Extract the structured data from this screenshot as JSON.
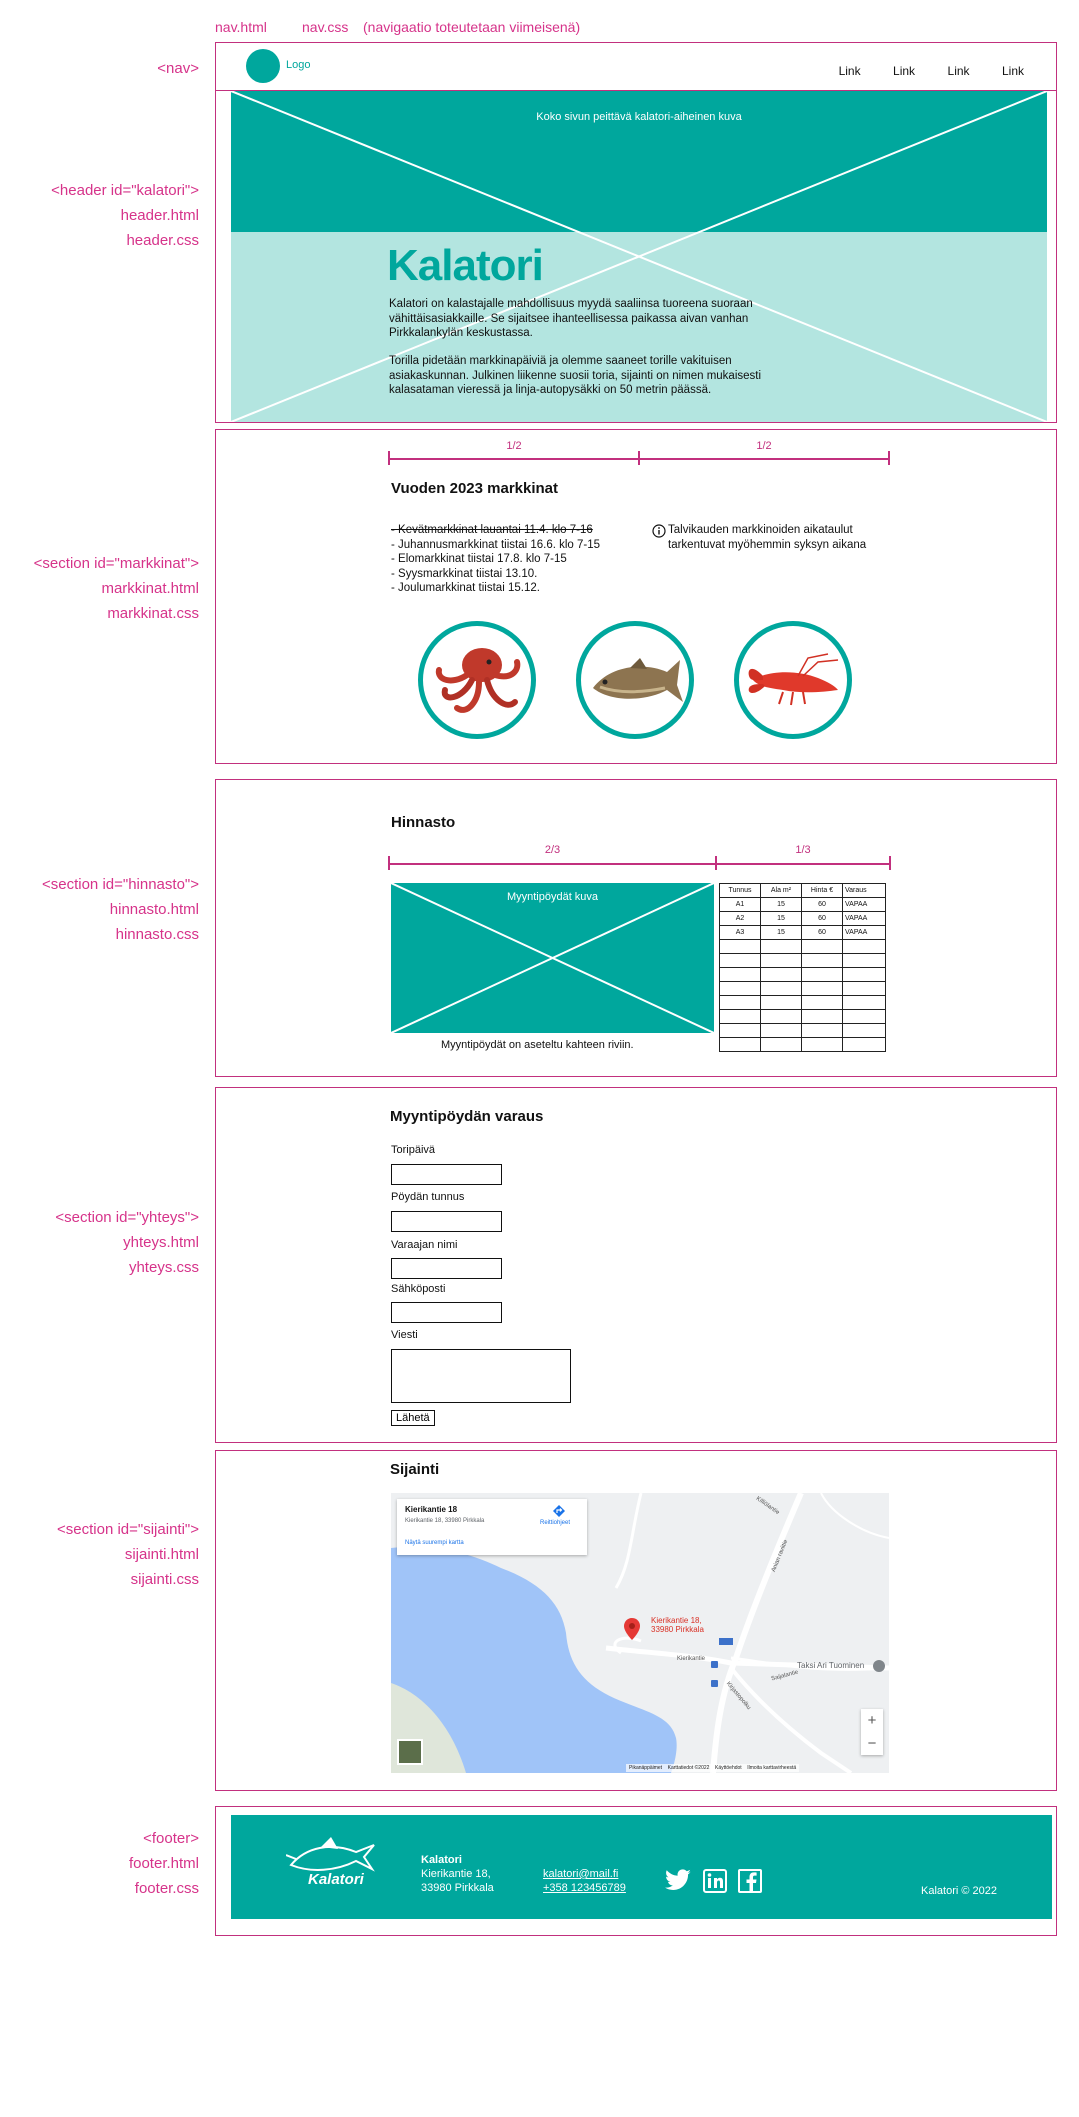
{
  "top_files": {
    "nav_html": "nav.html",
    "nav_css": "nav.css",
    "nav_note": "(navigaatio toteutetaan viimeisenä)"
  },
  "labels": {
    "nav": "<nav>",
    "header": [
      "<header id=\"kalatori\">",
      "header.html",
      "header.css"
    ],
    "markkinat": [
      "<section id=\"markkinat\">",
      "markkinat.html",
      "markkinat.css"
    ],
    "hinnasto": [
      "<section id=\"hinnasto\">",
      "hinnasto.html",
      "hinnasto.css"
    ],
    "yhteys": [
      "<section id=\"yhteys\">",
      "yhteys.html",
      "yhteys.css"
    ],
    "sijainti": [
      "<section id=\"sijainti\">",
      "sijainti.html",
      "sijainti.css"
    ],
    "footer": [
      "<footer>",
      "footer.html",
      "footer.css"
    ]
  },
  "nav": {
    "logo": "Logo",
    "links": [
      "Link",
      "Link",
      "Link",
      "Link"
    ]
  },
  "header": {
    "image_caption": "Koko sivun peittävä kalatori-aiheinen kuva",
    "title": "Kalatori",
    "paragraph1": "Kalatori on kalastajalle mahdollisuus myydä saaliinsa tuoreena suoraan vähittäisasiakkaille. Se sijaitsee ihanteellisessa paikassa aivan vanhan Pirkkalankylän keskustassa.",
    "paragraph2": "Torilla pidetään markkinapäiviä ja olemme saaneet torille vakituisen asiakaskunnan. Julkinen liikenne suosii toria, sijainti on nimen mukaisesti kalasataman vieressä ja linja-autopysäkki on 50 metrin päässä."
  },
  "markkinat": {
    "col_left": "1/2",
    "col_right": "1/2",
    "title": "Vuoden 2023 markkinat",
    "items": [
      "- Kevätmarkkinat lauantai 11.4. klo 7-16",
      "- Juhannusmarkkinat tiistai 16.6. klo 7-15",
      "- Elomarkkinat tiistai 17.8. klo 7-15",
      "- Syysmarkkinat tiistai 13.10.",
      "- Joulumarkkinat tiistai 15.12."
    ],
    "info_icon": "info-icon",
    "info_text_line1": "Talvikauden markkinoiden aikataulut",
    "info_text_line2": "tarkentuvat myöhemmin syksyn aikana",
    "images": [
      "octopus",
      "fish",
      "crayfish"
    ]
  },
  "hinnasto": {
    "title": "Hinnasto",
    "col_left": "2/3",
    "col_right": "1/3",
    "image_caption": "Myyntipöydät  kuva",
    "caption": "Myyntipöydät on aseteltu kahteen riviin.",
    "table": {
      "headers": [
        "Tunnus",
        "Ala m²",
        "Hinta €",
        "Varaus"
      ],
      "rows": [
        [
          "A1",
          "15",
          "60",
          "VAPAA"
        ],
        [
          "A2",
          "15",
          "60",
          "VAPAA"
        ],
        [
          "A3",
          "15",
          "60",
          "VAPAA"
        ],
        [
          "",
          "",
          "",
          ""
        ],
        [
          "",
          "",
          "",
          ""
        ],
        [
          "",
          "",
          "",
          ""
        ],
        [
          "",
          "",
          "",
          ""
        ],
        [
          "",
          "",
          "",
          ""
        ],
        [
          "",
          "",
          "",
          ""
        ],
        [
          "",
          "",
          "",
          ""
        ],
        [
          "",
          "",
          "",
          ""
        ]
      ]
    }
  },
  "yhteys": {
    "title": "Myyntipöydän varaus",
    "fields": [
      "Toripäivä",
      "Pöydän tunnus",
      "Varaajan nimi",
      "Sähköposti",
      "Viesti"
    ],
    "submit": "Lähetä"
  },
  "sijainti": {
    "title": "Sijainti",
    "card_title": "Kierikantie 18",
    "card_address": "Kierikantie 18, 33980 Pirkkala",
    "card_link": "Näytä suurempi kartta",
    "directions": "Reittiohjeet",
    "marker_label_1": "Kierikantie 18,",
    "marker_label_2": "33980 Pirkkala",
    "road_1": "Kierikantie",
    "road_2": "Anian raviitie",
    "road_3": "Killiölantie",
    "road_4": "Kirjastopolku",
    "road_5": "Saijalantie",
    "poi": "Taksi Ari Tuominen",
    "attribution": [
      "Pikanäppäimet",
      "Karttatiedot ©2022",
      "Käyttöehdot",
      "Ilmoita karttavirheestä"
    ],
    "zoom_in": "+",
    "zoom_out": "−",
    "colors": {
      "water": "#a0c4f8",
      "land": "#eef0f2",
      "marker": "#e53935"
    }
  },
  "footer": {
    "logo_text": "Kalatori",
    "name": "Kalatori",
    "street": "Kierikantie 18,",
    "city": "33980 Pirkkala",
    "email": "kalatori@mail.fi",
    "phone": "+358 123456789",
    "copyright": "Kalatori © 2022",
    "social": [
      "twitter-icon",
      "linkedin-icon",
      "facebook-icon"
    ]
  },
  "colors": {
    "teal": "#00a79d",
    "teal_light": "#b3e5e0",
    "magenta": "#c2307e"
  }
}
